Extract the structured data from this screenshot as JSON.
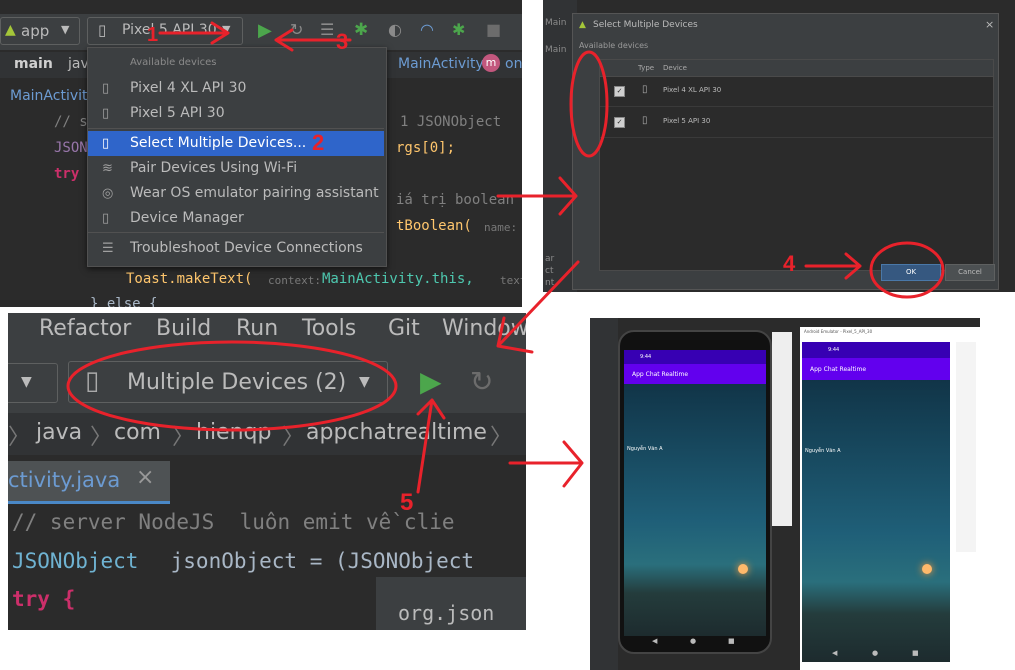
{
  "panel1": {
    "module_combo": "app",
    "device_combo": "Pixel 5 API 30",
    "breadcrumb": [
      "main",
      "java"
    ],
    "breadcrumb_class": "MainActivity",
    "breadcrumb_method": "on",
    "file_tab": "MainActivity",
    "menu": {
      "header": "Available devices",
      "items": [
        "Pixel 4 XL API 30",
        "Pixel 5 API 30",
        "Select Multiple Devices...",
        "Pair Devices Using Wi-Fi",
        "Wear OS emulator pairing assistant",
        "Device Manager",
        "Troubleshoot Device Connections"
      ]
    },
    "code": {
      "line1_comment": "// s",
      "line1_tail": "1 JSONObject",
      "line2_kw": "JSON",
      "line2_tail": "rgs[0];",
      "line3_kw": "try",
      "line4_tail": "iá trị boolean",
      "line5_tail": "tBoolean(",
      "line5_hint": "name:",
      "toast_line": "Toast.makeText(",
      "toast_hint": "context:",
      "toast_arg": "MainActivity.this,",
      "toast_hint2": "text",
      "else_line": "} else {"
    },
    "step_labels": [
      "1",
      "2",
      "3"
    ]
  },
  "panel2": {
    "title": "Select Multiple Devices",
    "section": "Available devices",
    "columns": [
      "Type",
      "Device"
    ],
    "rows": [
      {
        "device": "Pixel 4 XL API 30",
        "checked": true
      },
      {
        "device": "Pixel 5 API 30",
        "checked": true
      }
    ],
    "ok": "OK",
    "cancel": "Cancel",
    "side_text": [
      "Main",
      "Main",
      "ar",
      "ct",
      "nt"
    ],
    "step_label": "4"
  },
  "panel3": {
    "menu": [
      "Refactor",
      "Build",
      "Run",
      "Tools",
      "Git",
      "Window"
    ],
    "device_combo": "Multiple Devices (2)",
    "breadcrumb": [
      "java",
      "com",
      "hienqp",
      "appchatrealtime"
    ],
    "file_tab": "ctivity.java",
    "code_line1": "// server NodeJS  luôn emit về clie",
    "code_line2_a": "JSONObject",
    "code_line2_b": " jsonObject = (JSONObject",
    "code_line3": "try {",
    "popup": "org.json",
    "step_label": "5"
  },
  "panel4": {
    "emulator1": {
      "status": "9:44",
      "appbar": "App Chat Realtime",
      "message": "Nguyễn Văn A"
    },
    "emulator2": {
      "status": "9:44",
      "appbar": "App Chat Realtime",
      "message": "Nguyễn Văn A"
    },
    "emulator2_title": "Android Emulator - Pixel_5_API_30"
  },
  "colors": {
    "arrow": "#e8222b",
    "ide_dark": "#2b2b2b",
    "selection": "#2f65ca",
    "run_green": "#4ca64c",
    "appbar": "#6200ee",
    "status_bar": "#3700b3"
  }
}
